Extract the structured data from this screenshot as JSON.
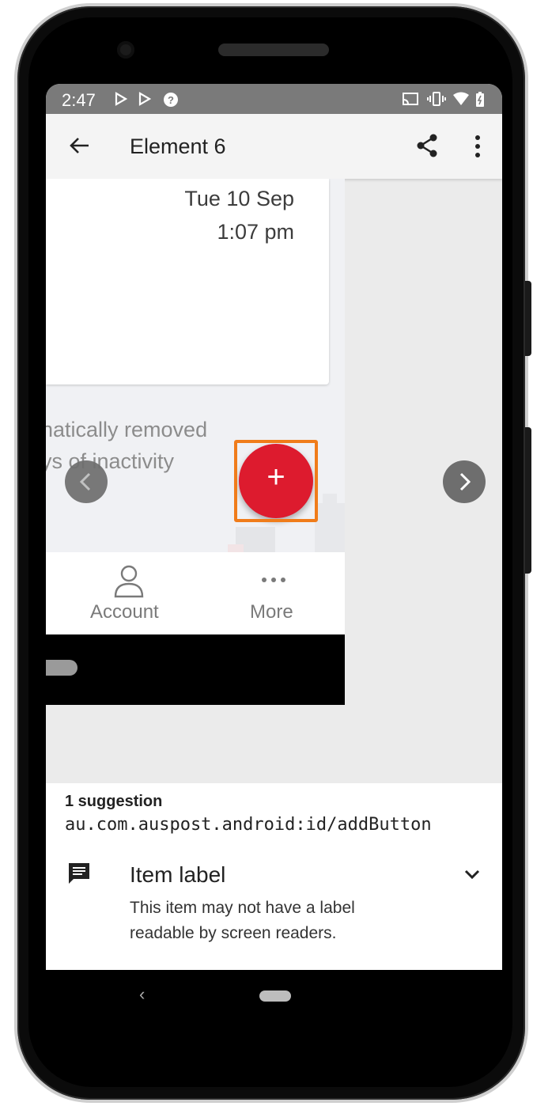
{
  "status_bar": {
    "time": "2:47",
    "left_icons": [
      "play-store-icon",
      "play-store-icon",
      "help-circle-icon"
    ],
    "right_icons": [
      "cast-icon",
      "vibrate-icon",
      "wifi-icon",
      "battery-icon"
    ]
  },
  "app_bar": {
    "title": "Element 6",
    "back_icon": "arrow-back-icon",
    "share_icon": "share-icon",
    "menu_icon": "more-vert-icon"
  },
  "preview": {
    "card_date": "Tue 10 Sep",
    "card_time": "1:07 pm",
    "background_text_line1": "natically removed",
    "background_text_line2": "ys of inactivity",
    "nav_items": [
      {
        "label": "Account",
        "icon": "person-icon"
      },
      {
        "label": "More",
        "icon": "more-horiz-icon"
      }
    ],
    "fab_symbol": "+"
  },
  "highlight_color": "#f07c1a",
  "fab_color": "#dd1b2e",
  "suggestion": {
    "count_text": "1 suggestion",
    "element_id": "au.com.auspost.android:id/addButton",
    "item_title": "Item label",
    "description_line1": "This item may not have a label",
    "description_line2": "readable by screen readers.",
    "icon": "message-icon",
    "expand_icon": "chevron-down-icon"
  },
  "system_nav": {
    "back_glyph": "‹"
  }
}
